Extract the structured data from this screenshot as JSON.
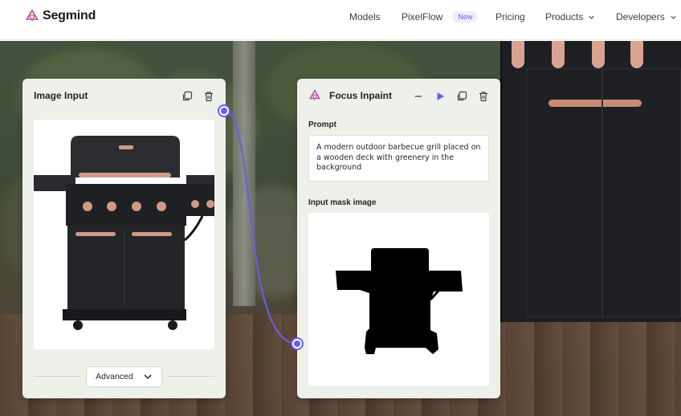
{
  "nav": {
    "brand": "Segmind",
    "items": [
      {
        "label": "Models"
      },
      {
        "label": "PixelFlow",
        "badge": "New"
      },
      {
        "label": "Pricing"
      },
      {
        "label": "Products",
        "has_dropdown": true
      },
      {
        "label": "Developers",
        "has_dropdown": true
      }
    ]
  },
  "image_input_node": {
    "title": "Image Input",
    "advanced_label": "Advanced"
  },
  "focus_inpaint_node": {
    "title": "Focus Inpaint",
    "prompt_label": "Prompt",
    "prompt_value": "A modern outdoor barbecue grill placed on a wooden deck with greenery in the background",
    "mask_label": "Input mask image"
  },
  "colors": {
    "accent": "#6b5cf0",
    "card_bg": "#eef0ea",
    "copper": "#d09a86"
  },
  "icons": [
    "segmind-logo-icon",
    "chevron-down-icon",
    "duplicate-icon",
    "trash-icon",
    "minus-icon",
    "play-icon"
  ]
}
